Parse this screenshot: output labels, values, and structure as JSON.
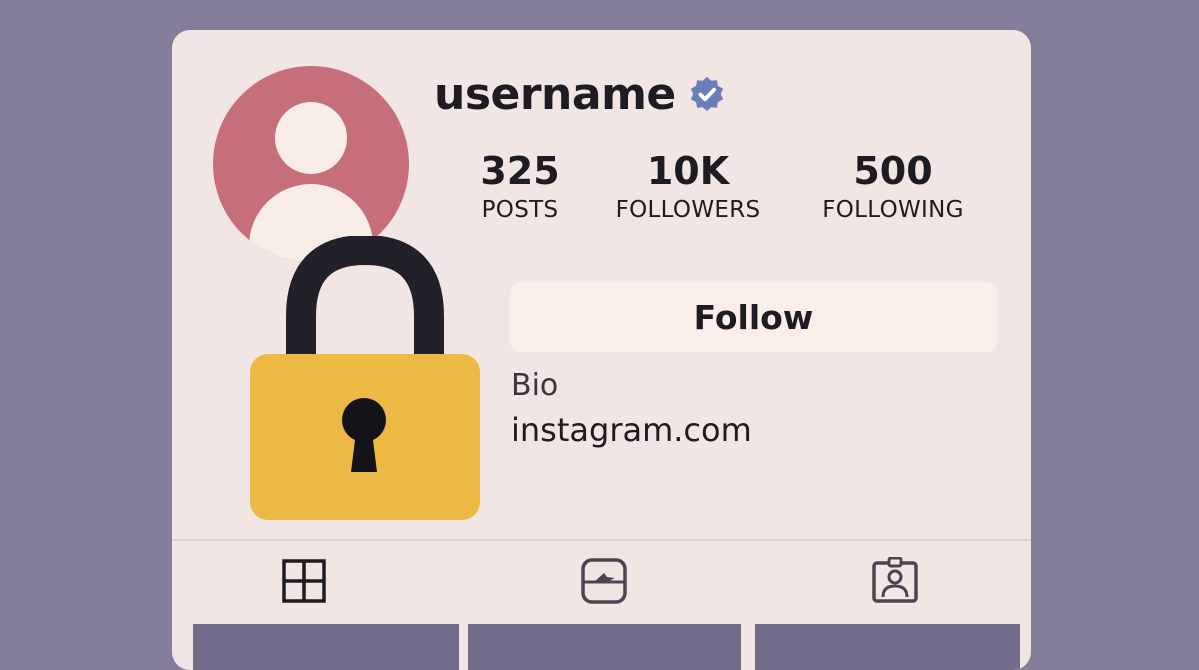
{
  "profile": {
    "username": "username",
    "verified_icon": "verified-badge-icon",
    "avatar_icon": "default-avatar-icon",
    "lock_icon": "padlock-icon"
  },
  "stats": {
    "posts": {
      "value": "325",
      "label": "POSTS"
    },
    "followers": {
      "value": "10K",
      "label": "FOLLOWERS"
    },
    "following": {
      "value": "500",
      "label": "FOLLOWING"
    }
  },
  "actions": {
    "follow_label": "Follow"
  },
  "bio": {
    "text": "Bio",
    "link": "instagram.com"
  },
  "tabs": [
    {
      "icon": "grid-icon"
    },
    {
      "icon": "reels-icon"
    },
    {
      "icon": "tagged-icon"
    }
  ],
  "colors": {
    "background": "#857e9b",
    "card": "#f1e6e4",
    "avatar": "#c66e7a",
    "lock_body": "#ecb945",
    "verified": "#6a7fb8",
    "tile": "#736c8a"
  }
}
